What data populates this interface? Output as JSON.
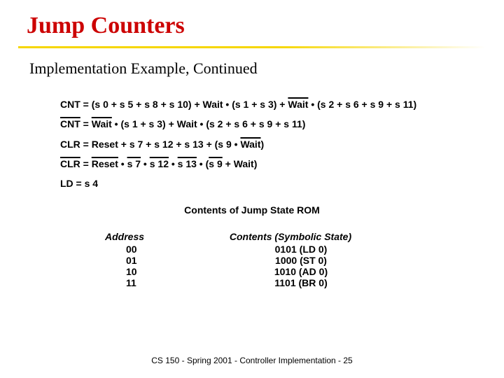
{
  "title": "Jump Counters",
  "subtitle": "Implementation Example, Continued",
  "eq": {
    "cnt1_a": "CNT = (s 0 + s 5 + s 8 + s 10) + Wait • (s 1 + s 3) + ",
    "cnt1_wait": "Wait",
    "cnt1_b": " • (s 2 + s 6 + s 9 + s 11)",
    "cnt2_cnt": "CNT",
    "cnt2_eq": " = ",
    "cnt2_wait1": "Wait",
    "cnt2_mid": " • (s 1 + s 3) + Wait • (s 2 + s 6 + s 9 + s 11)",
    "clr1_a": "CLR = Reset + s 7 + s 12 + s 13 + (s 9 • ",
    "clr1_wait": "Wait",
    "clr1_b": ")",
    "clr2_clr": "CLR",
    "clr2_eq": " = ",
    "clr2_reset": "Reset",
    "clr2_d1": " • ",
    "clr2_s7": "s 7",
    "clr2_d2": " • ",
    "clr2_s12": "s 12",
    "clr2_d3": " • ",
    "clr2_s13": "s 13",
    "clr2_d4": " • (",
    "clr2_s9": "s 9",
    "clr2_b": " + Wait)",
    "ld": "LD = s 4"
  },
  "rom": {
    "caption": "Contents of Jump State ROM",
    "hdr_addr": "Address",
    "hdr_cont": "Contents (Symbolic State)",
    "rows": [
      {
        "a": "00",
        "c": "0101 (LD 0)"
      },
      {
        "a": "01",
        "c": "1000 (ST 0)"
      },
      {
        "a": "10",
        "c": "1010 (AD 0)"
      },
      {
        "a": "11",
        "c": "1101 (BR 0)"
      }
    ]
  },
  "footer": "CS 150 - Spring 2001 - Controller Implementation - 25"
}
